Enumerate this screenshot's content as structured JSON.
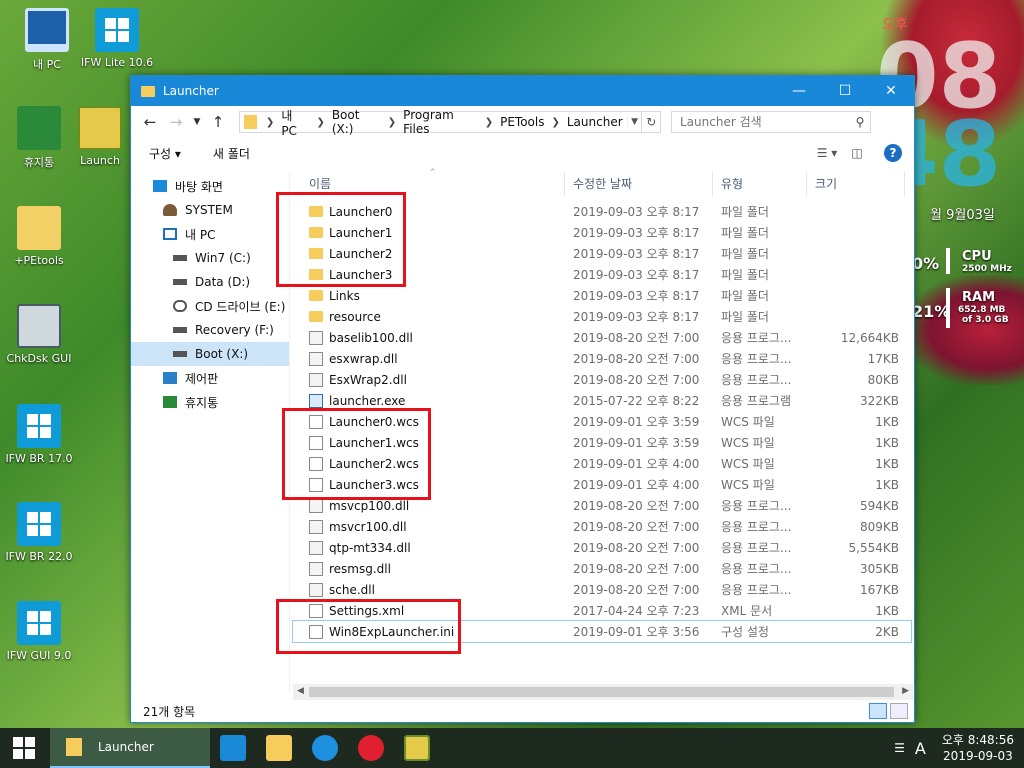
{
  "desktop": {
    "icons": [
      {
        "label": "내 PC",
        "icon": "computer-icon"
      },
      {
        "label": "IFW Lite 10.6",
        "icon": "windows-app-icon"
      },
      {
        "label": "휴지통",
        "icon": "recycle-bin-icon"
      },
      {
        "label": "Launch",
        "icon": "grid-app-icon"
      },
      {
        "label": "+PEtools",
        "icon": "file-shortcut-icon"
      },
      {
        "label": "ChkDsk GUI",
        "icon": "disk-icon"
      },
      {
        "label": "IFW BR 17.0",
        "icon": "windows-app-icon"
      },
      {
        "label": "IFW BR 22.0",
        "icon": "windows-app-icon"
      },
      {
        "label": "IFW GUI 9.0",
        "icon": "windows-app-icon"
      }
    ]
  },
  "widget": {
    "ampm": "오후",
    "hour": "08",
    "minute": "48",
    "date": "월 9월03일",
    "cpu": {
      "percent": "0%",
      "label": "CPU",
      "sub": "2500 MHz"
    },
    "ram": {
      "percent": "21%",
      "label": "RAM",
      "sub1": "652.8 MB",
      "sub2": "of 3.0 GB"
    }
  },
  "window": {
    "title": "Launcher",
    "controls": {
      "minimize": "—",
      "maximize": "☐",
      "close": "✕"
    },
    "address": {
      "crumbs": [
        "내 PC",
        "Boot (X:)",
        "Program Files",
        "PETools",
        "Launcher"
      ]
    },
    "search": {
      "placeholder": "Launcher 검색"
    },
    "commands": {
      "organize": "구성 ▾",
      "new_folder": "새 폴더"
    },
    "nav": [
      {
        "label": "바탕 화면",
        "icon": "desktop-icon",
        "indent": 0
      },
      {
        "label": "SYSTEM",
        "icon": "user-icon",
        "indent": 1
      },
      {
        "label": "내 PC",
        "icon": "computer-icon",
        "indent": 1
      },
      {
        "label": "Win7 (C:)",
        "icon": "drive-icon",
        "indent": 2
      },
      {
        "label": "Data (D:)",
        "icon": "drive-icon",
        "indent": 2
      },
      {
        "label": "CD 드라이브 (E:) •",
        "icon": "cd-drive-icon",
        "indent": 2
      },
      {
        "label": "Recovery (F:)",
        "icon": "drive-icon",
        "indent": 2
      },
      {
        "label": "Boot (X:)",
        "icon": "drive-icon",
        "indent": 2,
        "selected": true
      },
      {
        "label": "제어판",
        "icon": "control-panel-icon",
        "indent": 1
      },
      {
        "label": "휴지통",
        "icon": "recycle-bin-icon",
        "indent": 1
      }
    ],
    "columns": {
      "name": "이름",
      "date": "수정한 날짜",
      "type": "유형",
      "size": "크기"
    },
    "files": [
      {
        "name": "Launcher0",
        "date": "2019-09-03 오후 8:17",
        "type": "파일 폴더",
        "size": "",
        "icon": "folder-icon"
      },
      {
        "name": "Launcher1",
        "date": "2019-09-03 오후 8:17",
        "type": "파일 폴더",
        "size": "",
        "icon": "folder-icon"
      },
      {
        "name": "Launcher2",
        "date": "2019-09-03 오후 8:17",
        "type": "파일 폴더",
        "size": "",
        "icon": "folder-icon"
      },
      {
        "name": "Launcher3",
        "date": "2019-09-03 오후 8:17",
        "type": "파일 폴더",
        "size": "",
        "icon": "folder-icon"
      },
      {
        "name": "Links",
        "date": "2019-09-03 오후 8:17",
        "type": "파일 폴더",
        "size": "",
        "icon": "folder-icon"
      },
      {
        "name": "resource",
        "date": "2019-09-03 오후 8:17",
        "type": "파일 폴더",
        "size": "",
        "icon": "folder-icon"
      },
      {
        "name": "baselib100.dll",
        "date": "2019-08-20 오전 7:00",
        "type": "응용 프로그...",
        "size": "12,664KB",
        "icon": "dll-file-icon"
      },
      {
        "name": "esxwrap.dll",
        "date": "2019-08-20 오전 7:00",
        "type": "응용 프로그...",
        "size": "17KB",
        "icon": "dll-file-icon"
      },
      {
        "name": "EsxWrap2.dll",
        "date": "2019-08-20 오전 7:00",
        "type": "응용 프로그...",
        "size": "80KB",
        "icon": "dll-file-icon"
      },
      {
        "name": "launcher.exe",
        "date": "2015-07-22 오후 8:22",
        "type": "응용 프로그램",
        "size": "322KB",
        "icon": "exe-file-icon"
      },
      {
        "name": "Launcher0.wcs",
        "date": "2019-09-01 오후 3:59",
        "type": "WCS 파일",
        "size": "1KB",
        "icon": "document-icon"
      },
      {
        "name": "Launcher1.wcs",
        "date": "2019-09-01 오후 3:59",
        "type": "WCS 파일",
        "size": "1KB",
        "icon": "document-icon"
      },
      {
        "name": "Launcher2.wcs",
        "date": "2019-09-01 오후 4:00",
        "type": "WCS 파일",
        "size": "1KB",
        "icon": "document-icon"
      },
      {
        "name": "Launcher3.wcs",
        "date": "2019-09-01 오후 4:00",
        "type": "WCS 파일",
        "size": "1KB",
        "icon": "document-icon"
      },
      {
        "name": "msvcp100.dll",
        "date": "2019-08-20 오전 7:00",
        "type": "응용 프로그...",
        "size": "594KB",
        "icon": "dll-file-icon"
      },
      {
        "name": "msvcr100.dll",
        "date": "2019-08-20 오전 7:00",
        "type": "응용 프로그...",
        "size": "809KB",
        "icon": "dll-file-icon"
      },
      {
        "name": "qtp-mt334.dll",
        "date": "2019-08-20 오전 7:00",
        "type": "응용 프로그...",
        "size": "5,554KB",
        "icon": "dll-file-icon"
      },
      {
        "name": "resmsg.dll",
        "date": "2019-08-20 오전 7:00",
        "type": "응용 프로그...",
        "size": "305KB",
        "icon": "dll-file-icon"
      },
      {
        "name": "sche.dll",
        "date": "2019-08-20 오전 7:00",
        "type": "응용 프로그...",
        "size": "167KB",
        "icon": "dll-file-icon"
      },
      {
        "name": "Settings.xml",
        "date": "2017-04-24 오후 7:23",
        "type": "XML 문서",
        "size": "1KB",
        "icon": "xml-file-icon"
      },
      {
        "name": "Win8ExpLauncher.ini",
        "date": "2019-09-01 오후 3:56",
        "type": "구성 설정",
        "size": "2KB",
        "icon": "ini-file-icon",
        "focused": true
      }
    ],
    "status": "21개 항목"
  },
  "taskbar": {
    "active_label": "Launcher",
    "apps": [
      "monitor-app-icon",
      "file-explorer-icon",
      "refresh-app-icon",
      "close-app-icon",
      "grid-app-icon"
    ],
    "ime": "A",
    "kb": "☰",
    "time": "오후 8:48:56",
    "date": "2019-09-03"
  },
  "colors": {
    "accent": "#1988d8",
    "highlight": "#e8101a"
  }
}
